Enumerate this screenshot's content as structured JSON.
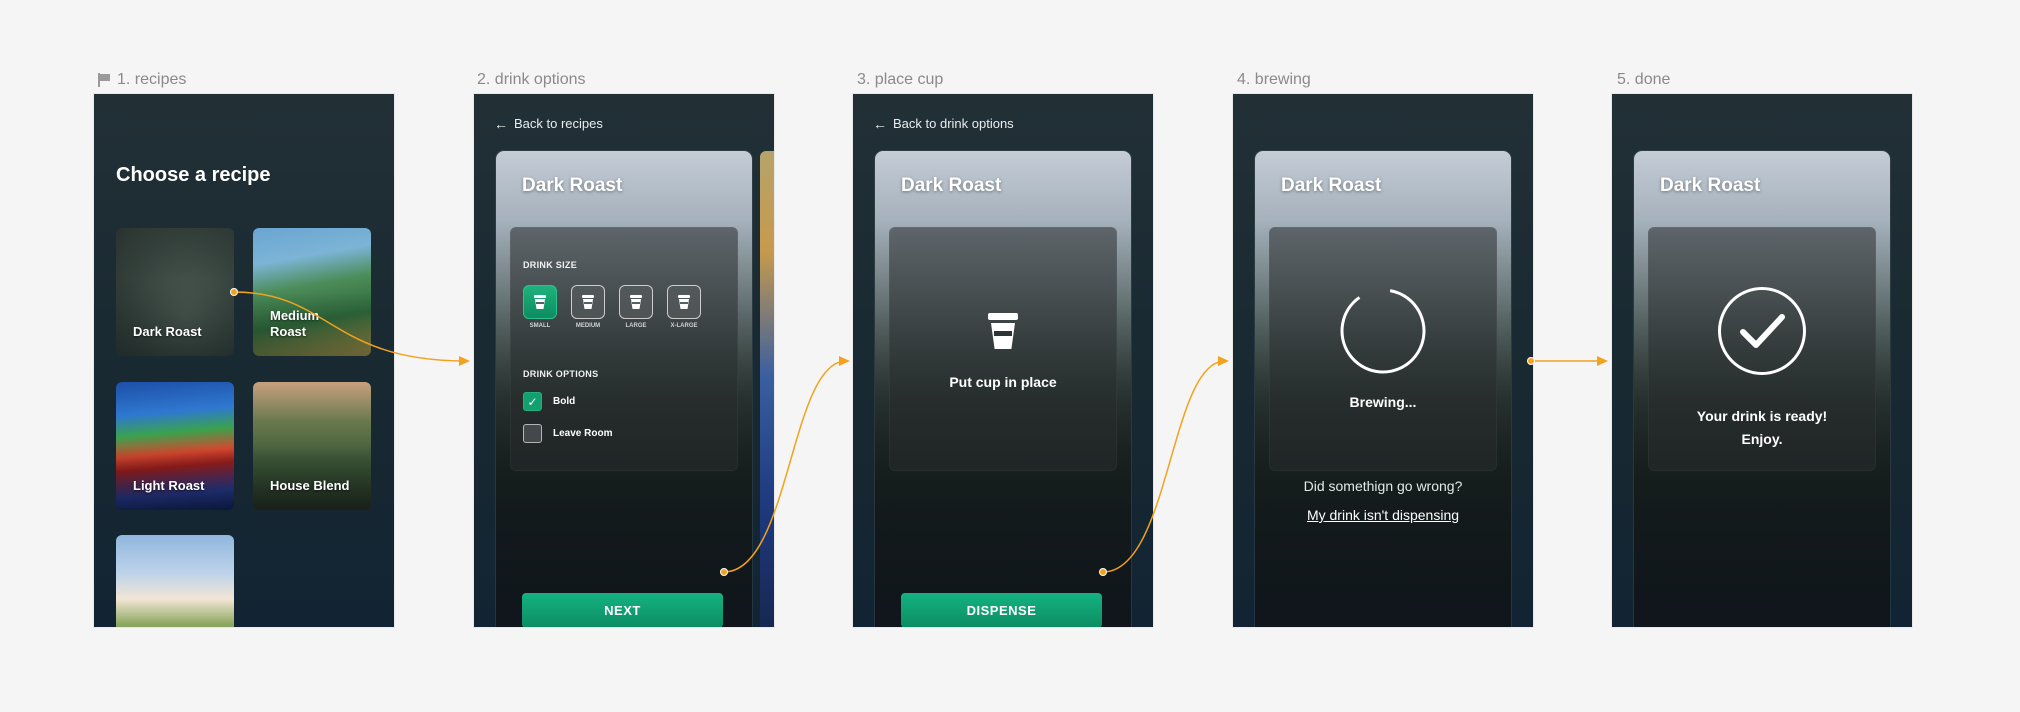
{
  "frames": [
    {
      "label": "1. recipes"
    },
    {
      "label": "2. drink options"
    },
    {
      "label": "3. place cup"
    },
    {
      "label": "4. brewing"
    },
    {
      "label": "5. done"
    }
  ],
  "recipes": {
    "title": "Choose a recipe",
    "tiles": [
      {
        "label": "Dark Roast"
      },
      {
        "label": "Medium\nRoast"
      },
      {
        "label": "Light Roast"
      },
      {
        "label": "House Blend"
      },
      {
        "label": ""
      }
    ]
  },
  "drink_options": {
    "back": "Back to recipes",
    "card_title": "Dark Roast",
    "size_section": "DRINK SIZE",
    "sizes": [
      {
        "label": "SMALL",
        "selected": true
      },
      {
        "label": "MEDIUM",
        "selected": false
      },
      {
        "label": "LARGE",
        "selected": false
      },
      {
        "label": "X-LARGE",
        "selected": false
      }
    ],
    "options_section": "DRINK OPTIONS",
    "options": [
      {
        "label": "Bold",
        "checked": true
      },
      {
        "label": "Leave Room",
        "checked": false
      }
    ],
    "next": "NEXT"
  },
  "place_cup": {
    "back": "Back to drink options",
    "card_title": "Dark Roast",
    "message": "Put cup in place",
    "dispense": "DISPENSE"
  },
  "brewing": {
    "card_title": "Dark Roast",
    "message": "Brewing...",
    "help_text": "Did somethign go wrong?",
    "help_link": "My drink isn't dispensing"
  },
  "done": {
    "card_title": "Dark Roast",
    "message_line1": "Your drink is ready!",
    "message_line2": "Enjoy."
  },
  "colors": {
    "accent": "#14b381",
    "connector": "#f2a21d"
  }
}
